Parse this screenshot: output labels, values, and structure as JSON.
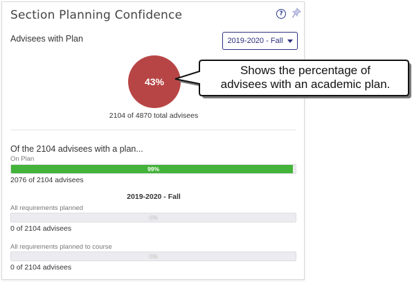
{
  "widget": {
    "title": "Section Planning Confidence",
    "help_glyph": "?",
    "help_icon": "question-circle-icon",
    "pin_icon": "pin-icon"
  },
  "advisees_with_plan": {
    "label": "Advisees with Plan",
    "term_dropdown": "2019-2020 - Fall",
    "percent_label": "43%",
    "percent_value": 43,
    "circle_color": "#b84545",
    "total_text": "2104 of 4870 total advisees"
  },
  "breakdown": {
    "heading": "Of the 2104 advisees with a plan...",
    "on_plan": {
      "label": "On Plan",
      "percent_label": "99%",
      "percent_value": 99,
      "count_text": "2076 of 2104 advisees",
      "color": "#43b339"
    },
    "term_heading": "2019-2020 - Fall",
    "all_requirements": {
      "label": "All requirements planned",
      "percent_label": "0%",
      "percent_value": 0,
      "count_text": "0 of 2104 advisees"
    },
    "all_requirements_to_course": {
      "label": "All requirements planned to course",
      "percent_label": "0%",
      "percent_value": 0,
      "count_text": "0 of 2104 advisees"
    }
  },
  "callout": {
    "line1": "Shows the percentage of",
    "line2": "advisees with an academic plan."
  }
}
